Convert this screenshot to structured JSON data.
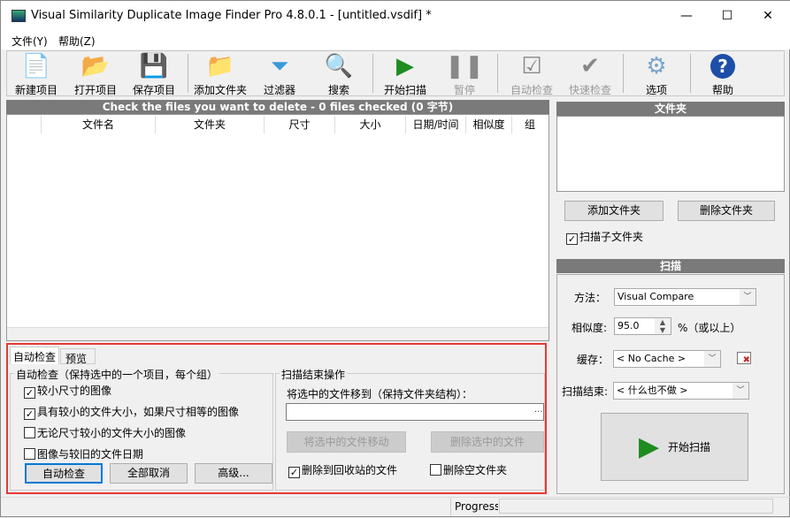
{
  "window": {
    "title": "Visual Similarity Duplicate Image Finder Pro 4.8.0.1 - [untitled.vsdif] *",
    "minimize": "—",
    "maximize": "☐",
    "close": "✕"
  },
  "menu": [
    "文件(Y)",
    "帮助(Z)"
  ],
  "toolbar": [
    {
      "label": "新建项目",
      "icon": "new-file-icon",
      "glyph": "📄",
      "enabled": true
    },
    {
      "label": "打开项目",
      "icon": "open-folder-icon",
      "glyph": "📂",
      "enabled": true
    },
    {
      "label": "保存项目",
      "icon": "save-disk-icon",
      "glyph": "💾",
      "enabled": true
    },
    {
      "label": "添加文件夹",
      "icon": "add-folder-icon",
      "glyph": "📁",
      "enabled": true
    },
    {
      "label": "过滤器",
      "icon": "filter-funnel-icon",
      "glyph": "⏷",
      "enabled": true
    },
    {
      "label": "搜索",
      "icon": "search-magnifier-icon",
      "glyph": "🔍",
      "enabled": true
    },
    {
      "label": "开始扫描",
      "icon": "play-icon",
      "glyph": "▶",
      "enabled": true
    },
    {
      "label": "暂停",
      "icon": "pause-icon",
      "glyph": "❚❚",
      "enabled": false
    },
    {
      "label": "自动检查",
      "icon": "auto-check-icon",
      "glyph": "☑",
      "enabled": false
    },
    {
      "label": "快速检查",
      "icon": "quick-check-icon",
      "glyph": "✔",
      "enabled": false
    },
    {
      "label": "选项",
      "icon": "gear-icon",
      "glyph": "⚙",
      "enabled": true
    },
    {
      "label": "帮助",
      "icon": "help-icon",
      "glyph": "?",
      "enabled": true
    }
  ],
  "files": {
    "header": "Check the files you want to delete - 0 files checked (0 字节)",
    "columns": [
      "文件名",
      "文件夹",
      "尺寸",
      "大小",
      "日期/时间",
      "相似度",
      "组"
    ]
  },
  "bottom": {
    "tabs": [
      "自动检查",
      "预览"
    ],
    "autocheck": {
      "legend": "自动检查（保持选中的一个项目，每个组）",
      "options": [
        {
          "label": "较小尺寸的图像",
          "checked": true
        },
        {
          "label": "具有较小的文件大小，如果尺寸相等的图像",
          "checked": true
        },
        {
          "label": "无论尺寸较小的文件大小的图像",
          "checked": false
        },
        {
          "label": "图像与较旧的文件日期",
          "checked": false
        }
      ],
      "buttons": [
        "自动检查",
        "全部取消",
        "高级..."
      ]
    },
    "after": {
      "legend": "扫描结束操作",
      "move_label": "将选中的文件移到（保持文件夹结构）：",
      "move_path": "",
      "browse": "...",
      "move_btn": "将选中的文件移动",
      "delete_btn": "删除选中的文件",
      "recycle": {
        "label": "删除到回收站的文件",
        "checked": true
      },
      "empty": {
        "label": "删除空文件夹",
        "checked": false
      }
    }
  },
  "folders": {
    "header": "文件夹",
    "add": "添加文件夹",
    "remove": "删除文件夹",
    "subfolders": {
      "label": "扫描子文件夹",
      "checked": true
    }
  },
  "scan": {
    "header": "扫描",
    "method_label": "方法：",
    "method": "Visual Compare",
    "similarity_label": "相似度:",
    "similarity": "95.0",
    "similarity_suffix": "%（或以上）",
    "cache_label": "缓存：",
    "cache": "< No Cache >",
    "end_label": "扫描结束:",
    "end": "< 什么也不做 >",
    "start": "开始扫描"
  },
  "status": {
    "progress_label": "Progress"
  },
  "colors": {
    "highlight": "#e53935",
    "play": "#1e8c1e"
  }
}
